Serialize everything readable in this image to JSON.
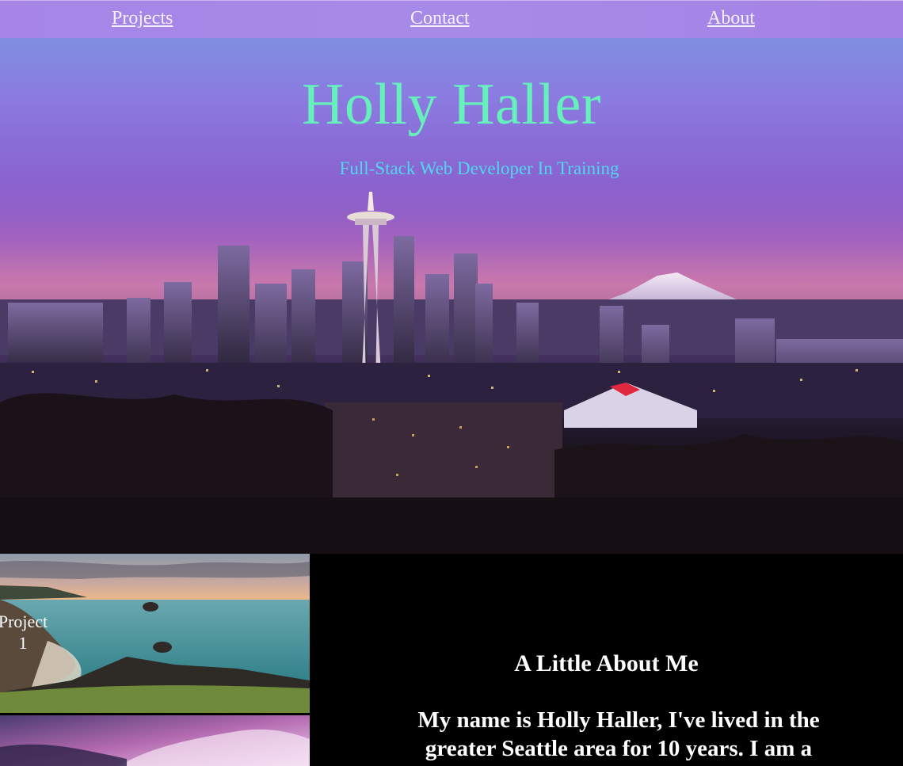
{
  "nav": {
    "items": [
      {
        "label": "Projects"
      },
      {
        "label": "Contact"
      },
      {
        "label": "About"
      }
    ]
  },
  "hero": {
    "title": "Holly Haller",
    "subtitle": "Full-Stack Web Developer In Training"
  },
  "projects": {
    "items": [
      {
        "label": "Project 1"
      }
    ]
  },
  "about": {
    "heading": "A Little About Me",
    "text": "My name is Holly Haller, I've lived in the greater Seattle area for 10 years. I am a"
  },
  "colors": {
    "nav_bg": "#a685e6",
    "title": "#66f0bc",
    "subtitle": "#4fd8ee",
    "about_bg": "#000000"
  }
}
